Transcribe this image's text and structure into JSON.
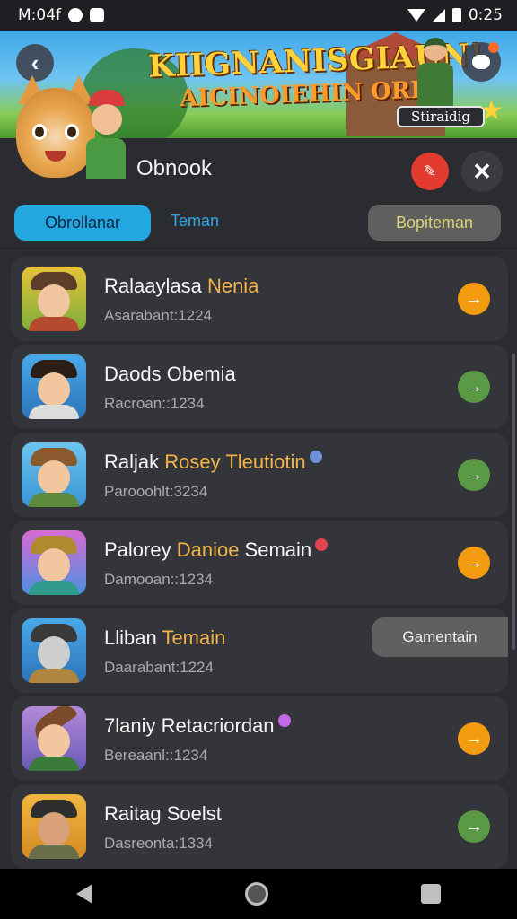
{
  "status_bar": {
    "left_text": "M:04f",
    "time": "0:25"
  },
  "banner": {
    "title": "KIIGNANISGIAUN!",
    "subtitle": "AICINOIEHIN ORKI",
    "badge": "Stiraidig"
  },
  "header": {
    "title": "Obnook"
  },
  "tabs": [
    {
      "label": "Obrollanar",
      "active": true
    },
    {
      "label": "Teman",
      "active": false
    },
    {
      "label": "Bopiteman",
      "active": false
    }
  ],
  "list": [
    {
      "name_main": "Ralaaylasa ",
      "name_highlight": "Nenia",
      "name_tail": "",
      "sub": "Asarabant:1224",
      "gem_color": "",
      "action_color": "#f39c12",
      "pill": ""
    },
    {
      "name_main": "Daods Obemia",
      "name_highlight": "",
      "name_tail": "",
      "sub": "Racroan::1234",
      "gem_color": "",
      "action_color": "#5a9a45",
      "pill": ""
    },
    {
      "name_main": "Raljak ",
      "name_highlight": "Rosey Tleutiotin",
      "name_tail": "",
      "sub": "Parooohlt:3234",
      "gem_color": "#6d8fd8",
      "action_color": "#5a9a45",
      "pill": ""
    },
    {
      "name_main": "Palorey ",
      "name_highlight": "Danioe",
      "name_tail": " Semain",
      "sub": "Damooan::1234",
      "gem_color": "#e0454e",
      "action_color": "#f39c12",
      "pill": ""
    },
    {
      "name_main": "Lliban ",
      "name_highlight": "Temain",
      "name_tail": "",
      "sub": "Daarabant:1224",
      "gem_color": "",
      "action_color": "",
      "pill": "Gamentain"
    },
    {
      "name_main": "7laniy Retacriordan",
      "name_highlight": "",
      "name_tail": "",
      "sub": "Bereaanl::1234",
      "gem_color": "#c169e6",
      "action_color": "#f39c12",
      "pill": ""
    },
    {
      "name_main": "Raitag Soelst",
      "name_highlight": "",
      "name_tail": "",
      "sub": "Dasreonta:1334",
      "gem_color": "",
      "action_color": "#5a9a45",
      "pill": ""
    }
  ],
  "icons": {
    "back": "chevron-left-icon",
    "chat": "chat-bubble-icon",
    "header_action": "megaphone-icon",
    "close": "close-icon",
    "row_action": "arrow-right-icon"
  },
  "colors": {
    "tab_active": "#23a7e0",
    "accent_orange": "#f39c12",
    "accent_green": "#5a9a45"
  }
}
